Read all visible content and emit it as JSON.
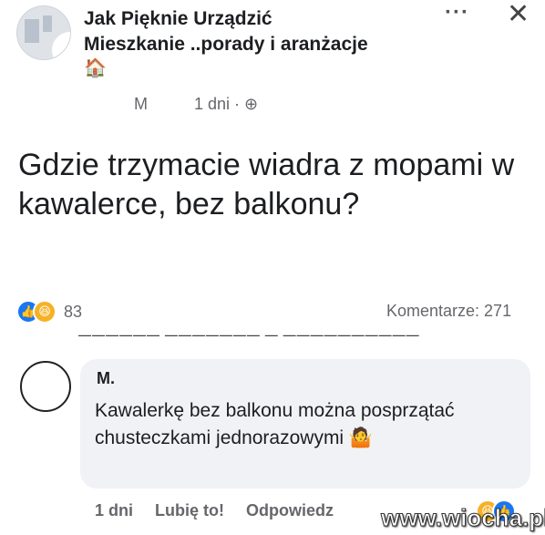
{
  "post": {
    "group_name": "Jak Pięknie Urządzić",
    "group_subtitle": "Mieszkanie ..porady i aranżacje",
    "group_emoji": "🏠",
    "more_label": "···",
    "close_label": "✕",
    "author": "M",
    "time": "1 dni · ⊕",
    "text": "Gdzie trzymacie wiadra z mopami w kawalerce, bez balkonu?"
  },
  "engagement": {
    "reaction_count": "83",
    "comments": "Komentarze: 271",
    "like_icon": "thumbs-up-icon",
    "haha_icon": "laughing-face-icon"
  },
  "comment": {
    "commenter": "M.",
    "text": "Kawalerkę bez balkonu można posprzątać chusteczkami jednorazowymi 🤷",
    "time": "1 dni",
    "like_label": "Lubię to!",
    "reply_label": "Odpowiedz"
  },
  "watermark": "www.wiocha.pl",
  "colors": {
    "like_blue": "#1877f2",
    "haha_yellow": "#f7b125",
    "bubble_gray": "#f0f2f5",
    "meta_gray": "#65676b"
  }
}
